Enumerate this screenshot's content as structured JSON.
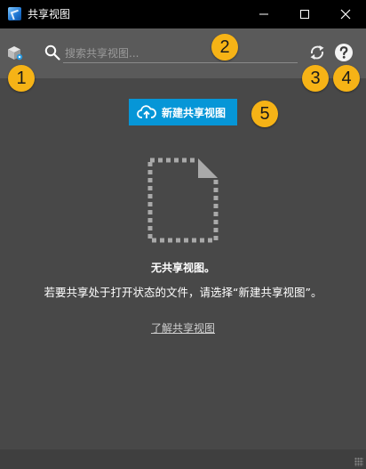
{
  "window": {
    "title": "共享视图",
    "controls": [
      "minimize-icon",
      "maximize-icon",
      "close-icon"
    ]
  },
  "toolbar": {
    "search_placeholder": "搜索共享视图...",
    "icons": [
      "cube-icon",
      "search-icon",
      "refresh-icon",
      "help-icon"
    ]
  },
  "callouts": [
    "1",
    "2",
    "3",
    "4",
    "5"
  ],
  "main": {
    "create_button_label": "新建共享视图",
    "empty_title": "无共享视图。",
    "empty_description": "若要共享处于打开状态的文件，请选择“新建共享视图”。",
    "learn_link": "了解共享视图"
  },
  "colors": {
    "accent": "#0696d7",
    "badge": "#f6b316",
    "panel": "#484848",
    "toolbar": "#5a5a5a",
    "titlebar": "#000000"
  }
}
